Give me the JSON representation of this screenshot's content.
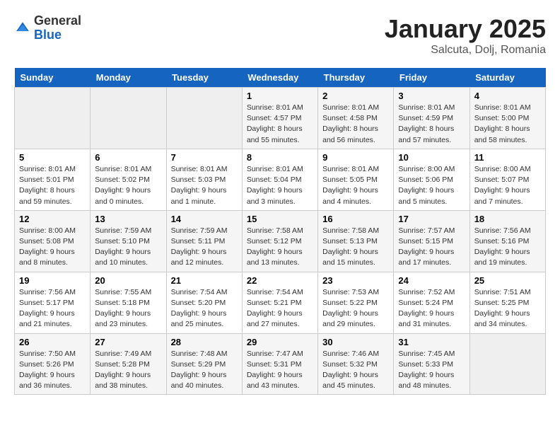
{
  "header": {
    "logo_general": "General",
    "logo_blue": "Blue",
    "month_title": "January 2025",
    "location": "Salcuta, Dolj, Romania"
  },
  "weekdays": [
    "Sunday",
    "Monday",
    "Tuesday",
    "Wednesday",
    "Thursday",
    "Friday",
    "Saturday"
  ],
  "weeks": [
    [
      {
        "day": "",
        "info": ""
      },
      {
        "day": "",
        "info": ""
      },
      {
        "day": "",
        "info": ""
      },
      {
        "day": "1",
        "info": "Sunrise: 8:01 AM\nSunset: 4:57 PM\nDaylight: 8 hours\nand 55 minutes."
      },
      {
        "day": "2",
        "info": "Sunrise: 8:01 AM\nSunset: 4:58 PM\nDaylight: 8 hours\nand 56 minutes."
      },
      {
        "day": "3",
        "info": "Sunrise: 8:01 AM\nSunset: 4:59 PM\nDaylight: 8 hours\nand 57 minutes."
      },
      {
        "day": "4",
        "info": "Sunrise: 8:01 AM\nSunset: 5:00 PM\nDaylight: 8 hours\nand 58 minutes."
      }
    ],
    [
      {
        "day": "5",
        "info": "Sunrise: 8:01 AM\nSunset: 5:01 PM\nDaylight: 8 hours\nand 59 minutes."
      },
      {
        "day": "6",
        "info": "Sunrise: 8:01 AM\nSunset: 5:02 PM\nDaylight: 9 hours\nand 0 minutes."
      },
      {
        "day": "7",
        "info": "Sunrise: 8:01 AM\nSunset: 5:03 PM\nDaylight: 9 hours\nand 1 minute."
      },
      {
        "day": "8",
        "info": "Sunrise: 8:01 AM\nSunset: 5:04 PM\nDaylight: 9 hours\nand 3 minutes."
      },
      {
        "day": "9",
        "info": "Sunrise: 8:01 AM\nSunset: 5:05 PM\nDaylight: 9 hours\nand 4 minutes."
      },
      {
        "day": "10",
        "info": "Sunrise: 8:00 AM\nSunset: 5:06 PM\nDaylight: 9 hours\nand 5 minutes."
      },
      {
        "day": "11",
        "info": "Sunrise: 8:00 AM\nSunset: 5:07 PM\nDaylight: 9 hours\nand 7 minutes."
      }
    ],
    [
      {
        "day": "12",
        "info": "Sunrise: 8:00 AM\nSunset: 5:08 PM\nDaylight: 9 hours\nand 8 minutes."
      },
      {
        "day": "13",
        "info": "Sunrise: 7:59 AM\nSunset: 5:10 PM\nDaylight: 9 hours\nand 10 minutes."
      },
      {
        "day": "14",
        "info": "Sunrise: 7:59 AM\nSunset: 5:11 PM\nDaylight: 9 hours\nand 12 minutes."
      },
      {
        "day": "15",
        "info": "Sunrise: 7:58 AM\nSunset: 5:12 PM\nDaylight: 9 hours\nand 13 minutes."
      },
      {
        "day": "16",
        "info": "Sunrise: 7:58 AM\nSunset: 5:13 PM\nDaylight: 9 hours\nand 15 minutes."
      },
      {
        "day": "17",
        "info": "Sunrise: 7:57 AM\nSunset: 5:15 PM\nDaylight: 9 hours\nand 17 minutes."
      },
      {
        "day": "18",
        "info": "Sunrise: 7:56 AM\nSunset: 5:16 PM\nDaylight: 9 hours\nand 19 minutes."
      }
    ],
    [
      {
        "day": "19",
        "info": "Sunrise: 7:56 AM\nSunset: 5:17 PM\nDaylight: 9 hours\nand 21 minutes."
      },
      {
        "day": "20",
        "info": "Sunrise: 7:55 AM\nSunset: 5:18 PM\nDaylight: 9 hours\nand 23 minutes."
      },
      {
        "day": "21",
        "info": "Sunrise: 7:54 AM\nSunset: 5:20 PM\nDaylight: 9 hours\nand 25 minutes."
      },
      {
        "day": "22",
        "info": "Sunrise: 7:54 AM\nSunset: 5:21 PM\nDaylight: 9 hours\nand 27 minutes."
      },
      {
        "day": "23",
        "info": "Sunrise: 7:53 AM\nSunset: 5:22 PM\nDaylight: 9 hours\nand 29 minutes."
      },
      {
        "day": "24",
        "info": "Sunrise: 7:52 AM\nSunset: 5:24 PM\nDaylight: 9 hours\nand 31 minutes."
      },
      {
        "day": "25",
        "info": "Sunrise: 7:51 AM\nSunset: 5:25 PM\nDaylight: 9 hours\nand 34 minutes."
      }
    ],
    [
      {
        "day": "26",
        "info": "Sunrise: 7:50 AM\nSunset: 5:26 PM\nDaylight: 9 hours\nand 36 minutes."
      },
      {
        "day": "27",
        "info": "Sunrise: 7:49 AM\nSunset: 5:28 PM\nDaylight: 9 hours\nand 38 minutes."
      },
      {
        "day": "28",
        "info": "Sunrise: 7:48 AM\nSunset: 5:29 PM\nDaylight: 9 hours\nand 40 minutes."
      },
      {
        "day": "29",
        "info": "Sunrise: 7:47 AM\nSunset: 5:31 PM\nDaylight: 9 hours\nand 43 minutes."
      },
      {
        "day": "30",
        "info": "Sunrise: 7:46 AM\nSunset: 5:32 PM\nDaylight: 9 hours\nand 45 minutes."
      },
      {
        "day": "31",
        "info": "Sunrise: 7:45 AM\nSunset: 5:33 PM\nDaylight: 9 hours\nand 48 minutes."
      },
      {
        "day": "",
        "info": ""
      }
    ]
  ]
}
